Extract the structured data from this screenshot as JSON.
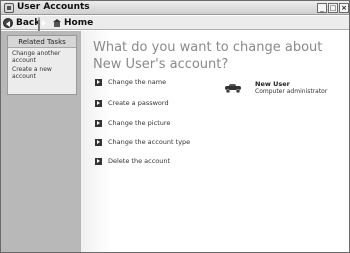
{
  "window": {
    "title": "User Accounts",
    "controls": {
      "minimize": "_",
      "maximize": "□",
      "close": "×"
    }
  },
  "toolbar": {
    "back_label": "Back",
    "home_label": "Home",
    "icons": {
      "back": "back-arrow-icon",
      "forward": "forward-arrow-icon",
      "home": "home-icon"
    }
  },
  "sidebar": {
    "panel_title": "Related Tasks",
    "links": [
      {
        "label": "Change another account"
      },
      {
        "label": "Create a new account"
      }
    ]
  },
  "main": {
    "heading": "What do you want to change about New User's account?",
    "options": [
      {
        "label": "Change the name"
      },
      {
        "label": "Create a password"
      },
      {
        "label": "Change the picture"
      },
      {
        "label": "Change the account type"
      },
      {
        "label": "Delete the account"
      }
    ],
    "user": {
      "name": "New User",
      "role": "Computer administrator",
      "picture_icon": "race-car-icon"
    }
  }
}
